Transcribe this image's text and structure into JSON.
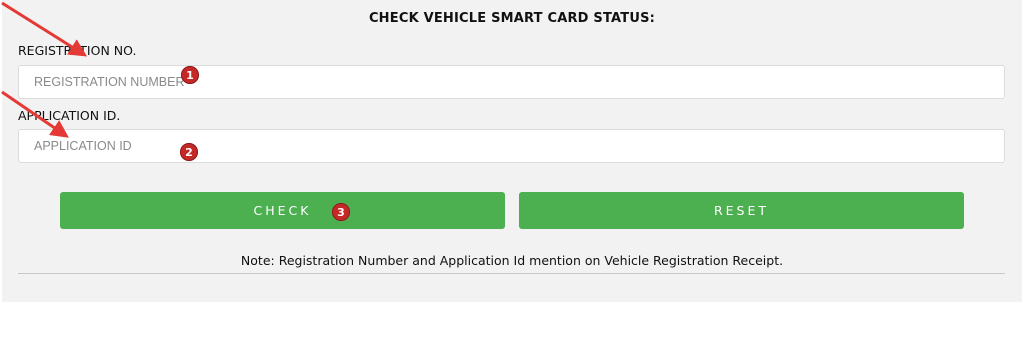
{
  "form": {
    "title": "CHECK VEHICLE SMART CARD STATUS:",
    "registration_label": "REGISTRATION NO.",
    "registration_placeholder": "REGISTRATION NUMBER",
    "application_label": "APPLICATION ID.",
    "application_placeholder": "APPLICATION ID",
    "check_label": "CHECK",
    "reset_label": "RESET",
    "note": "Note: Registration Number and Application Id mention on Vehicle Registration Receipt."
  },
  "annotations": {
    "badge_1": "1",
    "badge_2": "2",
    "badge_3": "3",
    "arrow_color": "#e53935",
    "badge_color": "#c62828"
  },
  "colors": {
    "button_green": "#4caf50",
    "panel_bg": "#f2f2f2"
  }
}
